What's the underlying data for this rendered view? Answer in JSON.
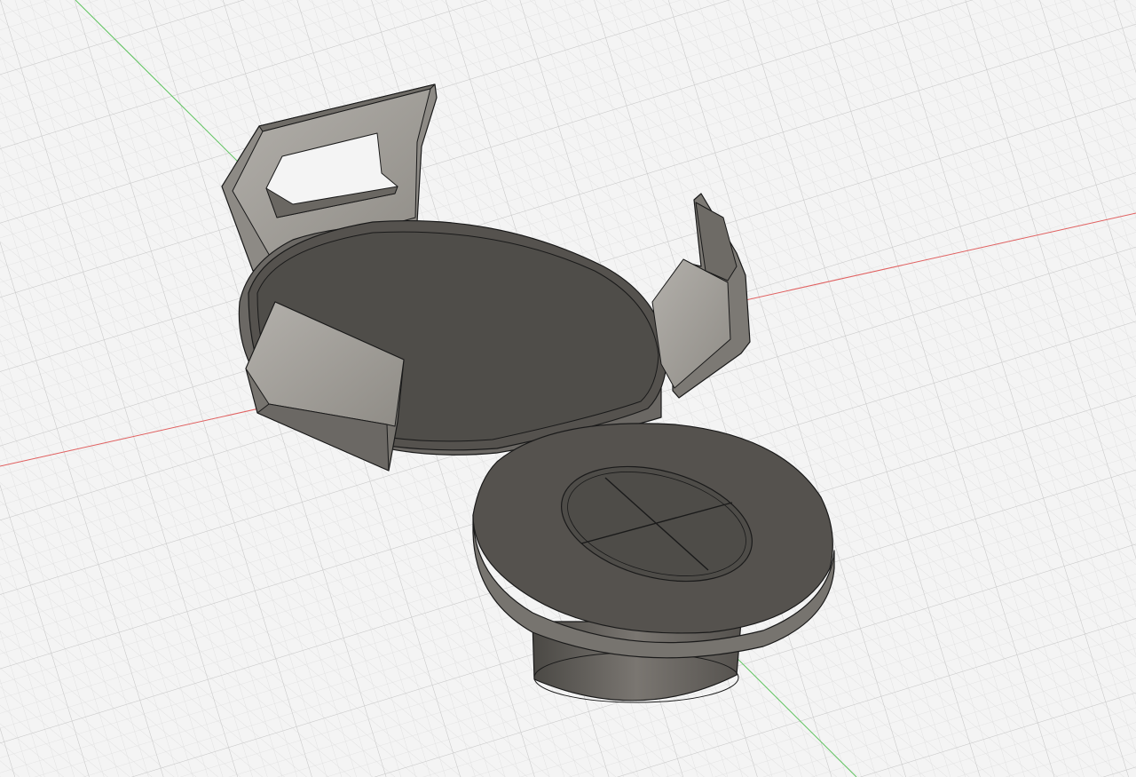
{
  "viewport": {
    "type": "3d-model-viewport",
    "view": "isometric",
    "background": "#f4f4f4",
    "grid_visible": true,
    "grid_minor_color": "#d9d9d9",
    "grid_major_color": "#c4c4c4",
    "axis_x_color": "#e06060",
    "axis_y_color": "#5fc35f"
  },
  "model": {
    "material_color": "#5a5753",
    "top_face_color": "#4f4d49",
    "side_face_color": "#6e6b66",
    "clip_face_color": "#9a9791",
    "clip_inner_color": "#7a7771",
    "edge_color": "#1a1a1a",
    "parts": [
      {
        "name": "main-plate",
        "shape": "circular-disc"
      },
      {
        "name": "small-disc",
        "shape": "circular-disc"
      },
      {
        "name": "cylinder-stem",
        "shape": "cylinder"
      },
      {
        "name": "back-clip",
        "shape": "slotted-arm"
      },
      {
        "name": "right-clip",
        "shape": "arm"
      },
      {
        "name": "front-clip",
        "shape": "arm"
      },
      {
        "name": "cross-emboss",
        "shape": "divided-circle"
      }
    ]
  }
}
